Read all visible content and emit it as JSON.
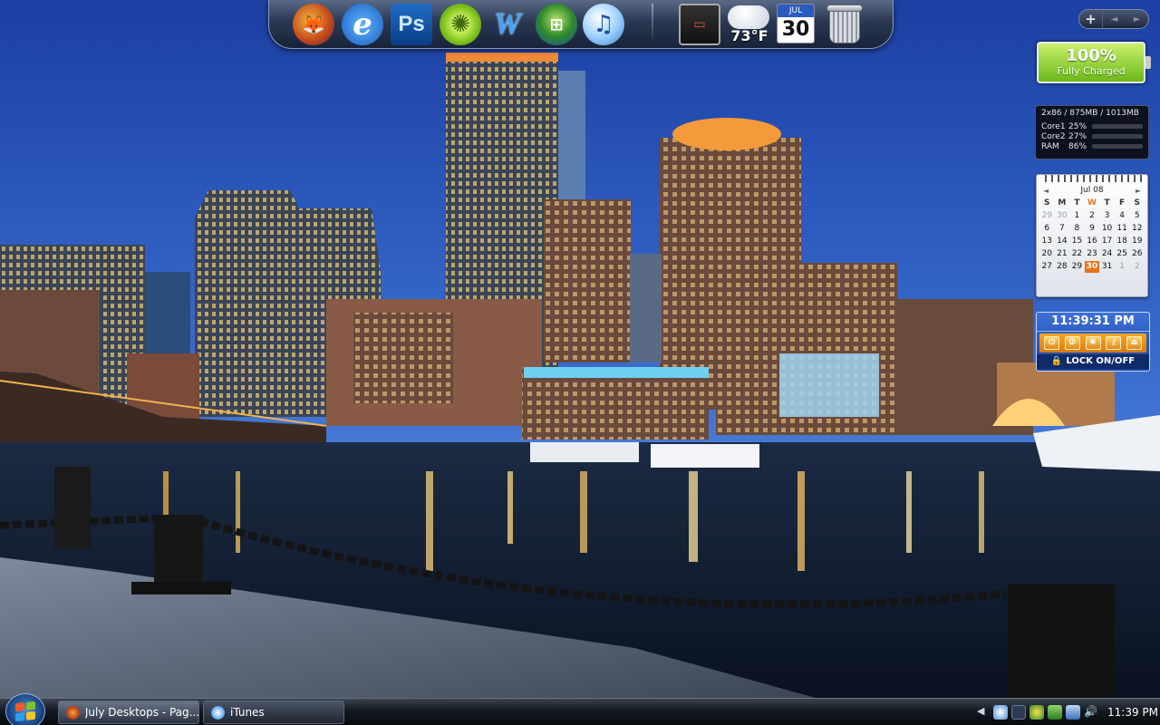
{
  "dock": {
    "icons": [
      {
        "name": "firefox-icon",
        "glyph": "🦊"
      },
      {
        "name": "internet-explorer-icon",
        "glyph": "e"
      },
      {
        "name": "photoshop-icon",
        "glyph": "Ps"
      },
      {
        "name": "limewire-icon",
        "glyph": "✺"
      },
      {
        "name": "word-icon",
        "glyph": "W"
      },
      {
        "name": "windows-icon",
        "glyph": "⊞"
      },
      {
        "name": "itunes-icon",
        "glyph": "♫"
      },
      {
        "name": "monitor-icon",
        "glyph": "▭"
      }
    ],
    "weather_temp": "73°F",
    "calendar_icon": {
      "month": "JUL",
      "day": "30"
    }
  },
  "sidebar": {
    "controls": {
      "add": "+",
      "prev": "◄",
      "next": "►"
    }
  },
  "battery": {
    "percent": "100%",
    "status": "Fully Charged"
  },
  "cpu_meter": {
    "header": "2x86 / 875MB / 1013MB",
    "rows": [
      {
        "label": "Core1",
        "value": "25%",
        "level": 0.25
      },
      {
        "label": "Core2",
        "value": "27%",
        "level": 0.27
      },
      {
        "label": "RAM",
        "value": "86%",
        "level": 0.86
      }
    ]
  },
  "calendar": {
    "month": "Jul 08",
    "days_of_week": [
      "S",
      "M",
      "T",
      "W",
      "T",
      "F",
      "S"
    ],
    "today_dow_index": 3,
    "weeks": [
      [
        "29",
        "30",
        "1",
        "2",
        "3",
        "4",
        "5"
      ],
      [
        "6",
        "7",
        "8",
        "9",
        "10",
        "11",
        "12"
      ],
      [
        "13",
        "14",
        "15",
        "16",
        "17",
        "18",
        "19"
      ],
      [
        "20",
        "21",
        "22",
        "23",
        "24",
        "25",
        "26"
      ],
      [
        "27",
        "28",
        "29",
        "30",
        "31",
        "1",
        "2"
      ]
    ],
    "current_day": "30"
  },
  "clock_gadget": {
    "time": "11:39:31 PM",
    "lock_label": "LOCK ON/OFF"
  },
  "taskbar": {
    "buttons": [
      {
        "label": "July Desktops - Pag...",
        "icon": "firefox-icon",
        "active": true
      },
      {
        "label": "iTunes",
        "icon": "itunes-icon",
        "active": false
      }
    ],
    "tray_clock": "11:39 PM"
  },
  "colors": {
    "accent_orange": "#e8731a",
    "battery_green": "#6cb81a",
    "taskbar_dark": "#151a22"
  }
}
